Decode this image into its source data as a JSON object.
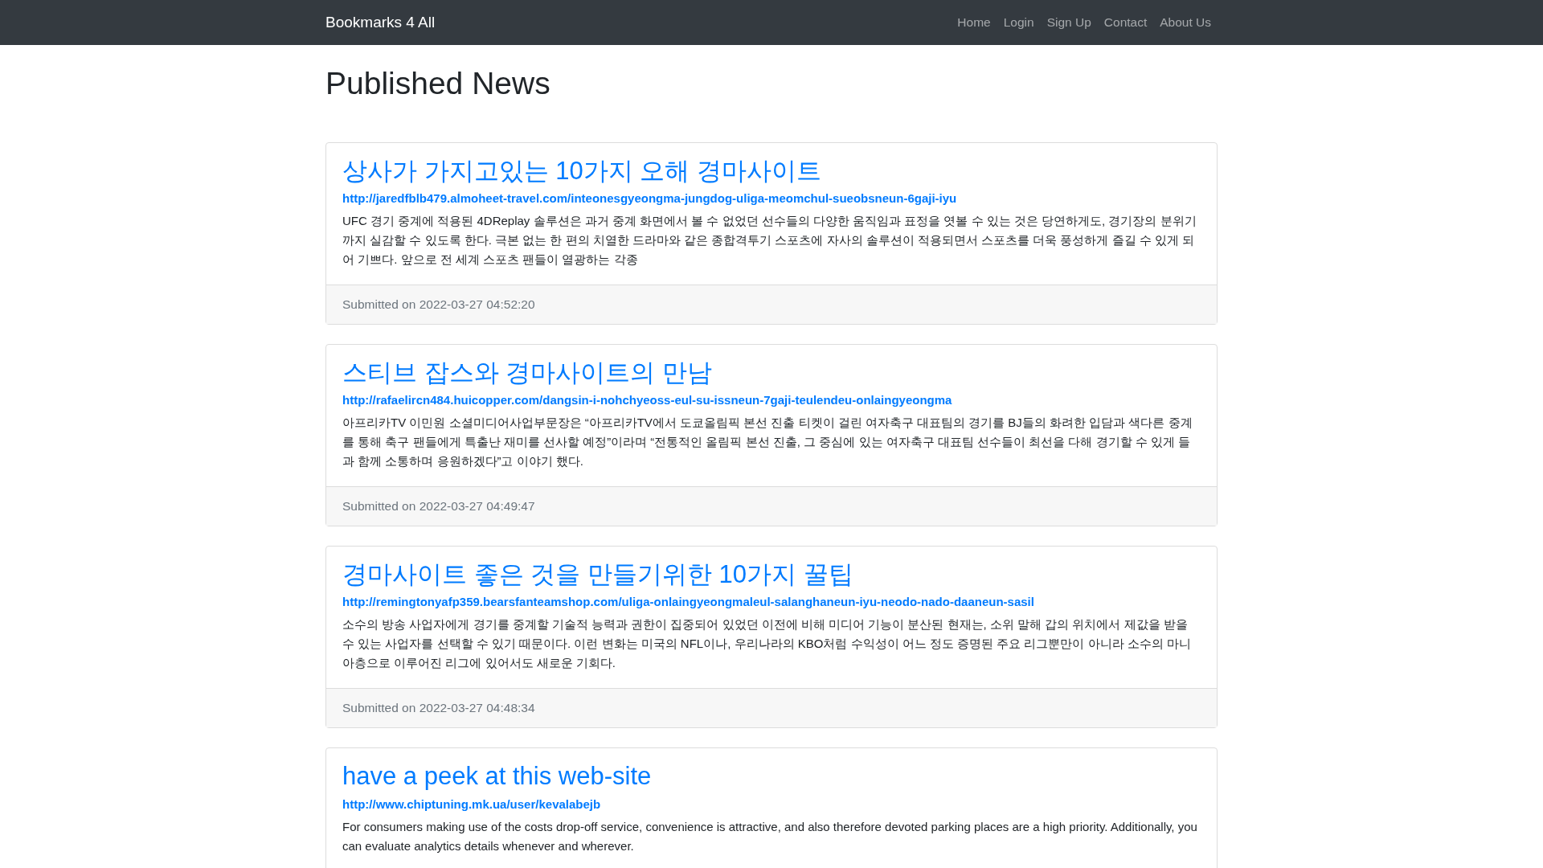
{
  "navbar": {
    "brand": "Bookmarks 4 All",
    "links": [
      "Home",
      "Login",
      "Sign Up",
      "Contact",
      "About Us"
    ]
  },
  "page_title": "Published News",
  "posts": [
    {
      "title": "상사가 가지고있는 10가지 오해 경마사이트",
      "url": "http://jaredfblb479.almoheet-travel.com/inteonesgyeongma-jungdog-uliga-meomchul-sueobsneun-6gaji-iyu",
      "body": "UFC 경기 중계에 적용된 4DReplay 솔루션은 과거 중계 화면에서 볼 수 없었던 선수들의 다양한 움직임과 표정을 엿볼 수 있는 것은 당연하게도, 경기장의 분위기까지 실감할 수 있도록 한다. 극본 없는 한 편의 치열한 드라마와 같은 종합격투기 스포츠에 자사의 솔루션이 적용되면서 스포츠를 더욱 풍성하게 즐길 수 있게 되어 기쁘다. 앞으로 전 세계 스포츠 팬들이 열광하는 각종",
      "submitted": "Submitted on 2022-03-27 04:52:20"
    },
    {
      "title": "스티브 잡스와 경마사이트의 만남",
      "url": "http://rafaelircn484.huicopper.com/dangsin-i-nohchyeoss-eul-su-issneun-7gaji-teulendeu-onlaingyeongma",
      "body": "아프리카TV 이민원 소셜미디어사업부문장은 “아프리카TV에서 도쿄올림픽 본선 진출 티켓이 걸린 여자축구 대표팀의 경기를 BJ들의 화려한 입담과 색다른 중계를 통해 축구 팬들에게 특출난 재미를 선사할 예정”이라며 “전통적인 올림픽 본선 진출, 그 중심에 있는 여자축구 대표팀 선수들이 최선을 다해 경기할 수 있게 들과 함께 소통하며 응원하겠다”고 이야기 했다.",
      "submitted": "Submitted on 2022-03-27 04:49:47"
    },
    {
      "title": "경마사이트 좋은 것을 만들기위한 10가지 꿀팁",
      "url": "http://remingtonyafp359.bearsfanteamshop.com/uliga-onlaingyeongmaleul-salanghaneun-iyu-neodo-nado-daaneun-sasil",
      "body": "소수의 방송 사업자에게 경기를 중계할 기술적 능력과 권한이 집중되어 있었던 이전에 비해 미디어 기능이 분산된 현재는, 소위 말해 갑의 위치에서 제값을 받을 수 있는 사업자를 선택할 수 있기 때문이다. 이런 변화는 미국의 NFL이나, 우리나라의 KBO처럼 수익성이 어느 정도 증명된 주요 리그뿐만이 아니라 소수의 마니아층으로 이루어진 리그에 있어서도 새로운 기회다.",
      "submitted": "Submitted on 2022-03-27 04:48:34"
    },
    {
      "title": "have a peek at this web-site",
      "url": "http://www.chiptuning.mk.ua/user/kevalabejb",
      "body": "For consumers making use of the costs drop-off service, convenience is attractive, and also therefore devoted parking places are a high priority. Additionally, you can evaluate analytics details whenever and wherever."
    }
  ]
}
